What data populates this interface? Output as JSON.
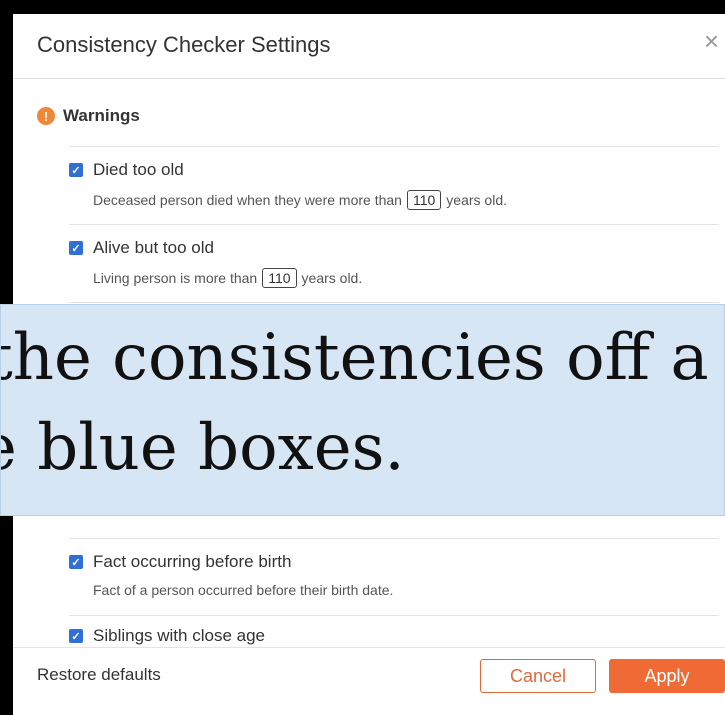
{
  "dialog": {
    "title": "Consistency Checker Settings",
    "close_glyph": "×"
  },
  "warnings": {
    "label": "Warnings",
    "icon_glyph": "!",
    "rules": [
      {
        "title": "Died too old",
        "checked": true,
        "desc_before": "Deceased person died when they were more than",
        "value": "110",
        "desc_after": "years old."
      },
      {
        "title": "Alive but too old",
        "checked": true,
        "desc_before": "Living person is more than",
        "value": "110",
        "desc_after": "years old."
      },
      {
        "title": "Fact occurring before birth",
        "checked": true,
        "desc": "Fact of a person occurred before their birth date."
      },
      {
        "title": "Siblings with close age",
        "checked": true
      }
    ]
  },
  "overlay": {
    "line1": "the consistencies off a",
    "line2": "e blue boxes."
  },
  "footer": {
    "restore_label": "Restore defaults",
    "cancel_label": "Cancel",
    "apply_label": "Apply"
  },
  "colors": {
    "accent_orange": "#f06a35",
    "checkbox_blue": "#2f6fd6",
    "overlay_blue": "#d6e6f5",
    "warning_icon": "#f0883a"
  }
}
